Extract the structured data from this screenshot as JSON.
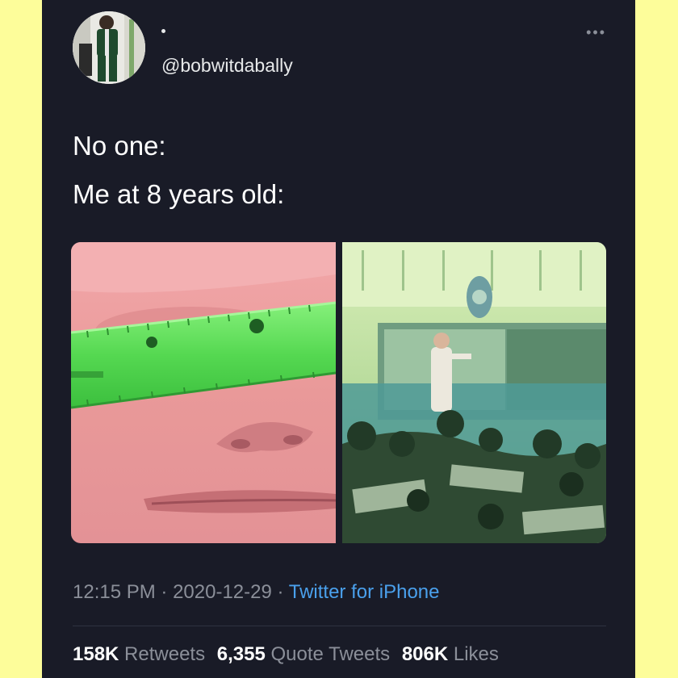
{
  "tweet": {
    "display_name": "",
    "handle": "@bobwitdabally",
    "more_icon": "more-horizontal-icon",
    "lines": [
      "No one:",
      "Me at 8 years old:"
    ],
    "meta": {
      "time": "12:15 PM",
      "date": "2020-12-29",
      "separator": " · ",
      "source": "Twitter for iPhone"
    },
    "stats": {
      "retweets_count": "158K",
      "retweets_label": "Retweets",
      "quotes_count": "6,355",
      "quotes_label": "Quote Tweets",
      "likes_count": "806K",
      "likes_label": "Likes"
    }
  },
  "colors": {
    "page_background": "#fdfd9a",
    "card_background": "#191b27",
    "link_blue": "#4aa0ec",
    "ruler_green": "#5ee05a"
  }
}
